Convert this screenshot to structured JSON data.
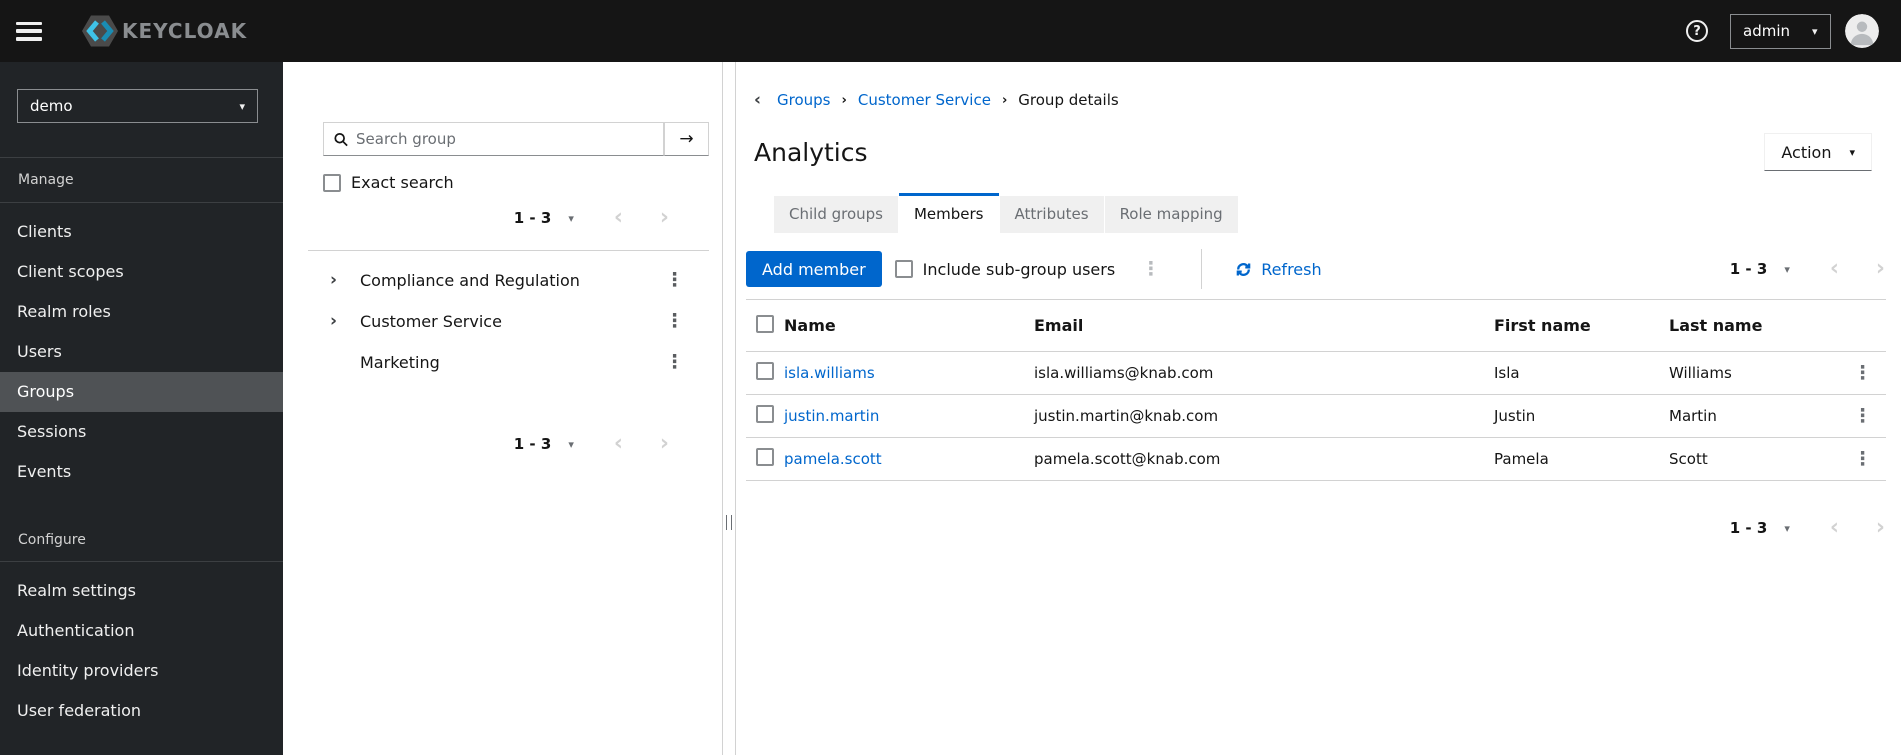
{
  "icons": {
    "caret_down": "▾",
    "kebab": "⋮",
    "angle_left": "‹",
    "angle_right": "›",
    "arrow_right": "→",
    "help": "?"
  },
  "colors": {
    "primary": "#0066cc",
    "link": "#0066cc",
    "topbar_bg": "#151515",
    "sidebar_bg": "#212427",
    "sidebar_selected_bg": "#4f5255",
    "border": "#d2d2d2",
    "muted_text": "#6a6e73",
    "tab_inactive_bg": "#f0f0f0"
  },
  "topbar": {
    "brand": "KEYCLOAK",
    "user_menu_label": "admin"
  },
  "sidebar": {
    "realm_selector_value": "demo",
    "manage_section": {
      "label": "Manage",
      "items": [
        "Clients",
        "Client scopes",
        "Realm roles",
        "Users",
        "Groups",
        "Sessions",
        "Events"
      ],
      "selected_item": "Groups"
    },
    "configure_section": {
      "label": "Configure",
      "items": [
        "Realm settings",
        "Authentication",
        "Identity providers",
        "User federation"
      ]
    }
  },
  "tree_panel": {
    "search_placeholder": "Search group",
    "exact_search_label": "Exact search",
    "pagination_top_range": "1 - 3",
    "pagination_bottom_range": "1 - 3",
    "groups": [
      {
        "name": "Compliance and Regulation",
        "expandable": true
      },
      {
        "name": "Customer Service",
        "expandable": true
      },
      {
        "name": "Marketing",
        "expandable": false
      }
    ]
  },
  "main": {
    "breadcrumb": {
      "items": [
        {
          "label": "Groups",
          "is_link": true
        },
        {
          "label": "Customer Service",
          "is_link": true
        },
        {
          "label": "Group details",
          "is_link": false
        }
      ]
    },
    "title": "Analytics",
    "action_button_label": "Action",
    "tabs": {
      "items": [
        "Child groups",
        "Members",
        "Attributes",
        "Role mapping"
      ],
      "active": "Members"
    },
    "toolbar": {
      "add_member_label": "Add member",
      "include_subgroups_label": "Include sub-group users",
      "refresh_label": "Refresh",
      "pagination_range": "1 - 3"
    },
    "members_table": {
      "columns": [
        "Name",
        "Email",
        "First name",
        "Last name"
      ],
      "rows": [
        {
          "name": "isla.williams",
          "email": "isla.williams@knab.com",
          "first_name": "Isla",
          "last_name": "Williams"
        },
        {
          "name": "justin.martin",
          "email": "justin.martin@knab.com",
          "first_name": "Justin",
          "last_name": "Martin"
        },
        {
          "name": "pamela.scott",
          "email": "pamela.scott@knab.com",
          "first_name": "Pamela",
          "last_name": "Scott"
        }
      ]
    },
    "pagination_bottom_range": "1 - 3"
  }
}
